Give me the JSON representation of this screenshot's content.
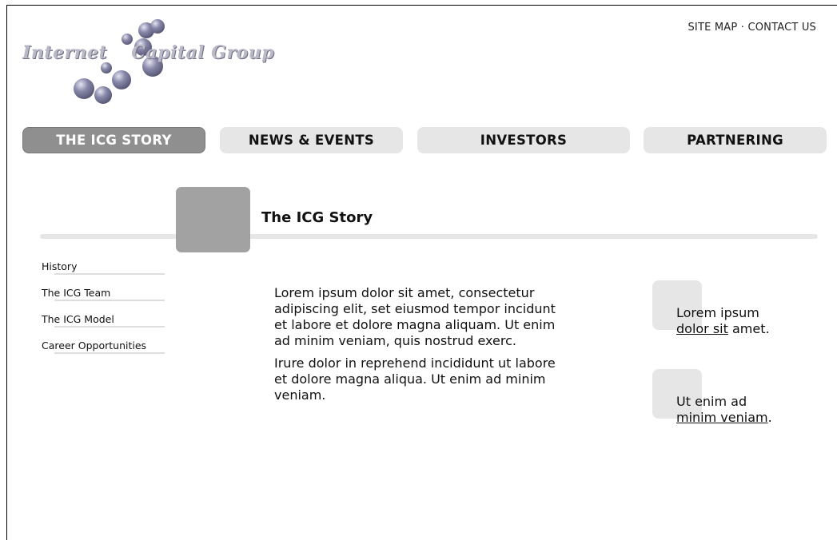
{
  "logo": {
    "word1": "Internet",
    "word2": "Capital",
    "word3": "Group"
  },
  "toplinks": {
    "site_map": "SITE MAP",
    "separator": "·",
    "contact_us": "CONTACT US"
  },
  "nav": {
    "items": [
      {
        "label": "THE ICG STORY",
        "active": true
      },
      {
        "label": "NEWS & EVENTS",
        "active": false
      },
      {
        "label": "INVESTORS",
        "active": false
      },
      {
        "label": "PARTNERING",
        "active": false
      }
    ]
  },
  "section": {
    "title": "The ICG Story"
  },
  "subnav": {
    "items": [
      {
        "label": "History"
      },
      {
        "label": "The ICG Team"
      },
      {
        "label": "The ICG Model"
      },
      {
        "label": "Career Opportunities"
      }
    ]
  },
  "body": {
    "paragraphs": [
      "Lorem ipsum dolor sit amet, consectetur adipiscing elit, set eiusmod tempor incidunt et labore et dolore magna aliquam. Ut enim ad minim veniam, quis nostrud exerc.",
      "Irure dolor in reprehend incididunt ut labore et dolore magna aliqua. Ut enim ad minim veniam."
    ]
  },
  "promos": [
    {
      "text_before": "Lorem ipsum",
      "link": "dolor sit",
      "text_after": " amet."
    },
    {
      "text_before": "Ut enim ad",
      "link": "minim veniam",
      "text_after": "."
    }
  ],
  "colors": {
    "nav_inactive": "#e6e6e6",
    "nav_active": "#8f8f8f",
    "section_box": "#a2a2a2",
    "rule": "#e6e6e6"
  }
}
